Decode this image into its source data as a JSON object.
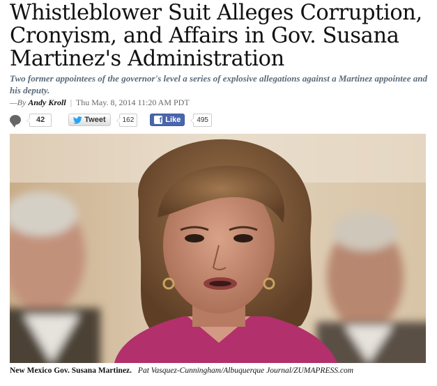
{
  "article": {
    "headline": "Whistleblower Suit Alleges Corruption, Cronyism, and Affairs in Gov. Susana Martinez's Administration",
    "dek": "Two former appointees of the governor's level a series of explosive allegations against a Martinez appointee and his deputy.",
    "byline": {
      "prefix": "—By",
      "author": "Andy Kroll",
      "separator": "|",
      "date": "Thu May. 8, 2014 11:20 AM PDT"
    }
  },
  "social": {
    "comments": {
      "icon": "comment-icon",
      "count": "42"
    },
    "tweet": {
      "icon": "twitter-bird-icon",
      "label": "Tweet",
      "count": "162"
    },
    "like": {
      "icon": "facebook-icon",
      "glyph": "f",
      "label": "Like",
      "count": "495"
    }
  },
  "photo": {
    "caption": {
      "subject": "New Mexico Gov. Susana Martinez.",
      "credit": "Pat Vasquez-Cunningham/Albuquerque Journal/ZUMAPRESS.com"
    }
  },
  "colors": {
    "dek": "#5a6a7a",
    "facebook": "#4a66ad",
    "twitter": "#2aa3ef"
  }
}
